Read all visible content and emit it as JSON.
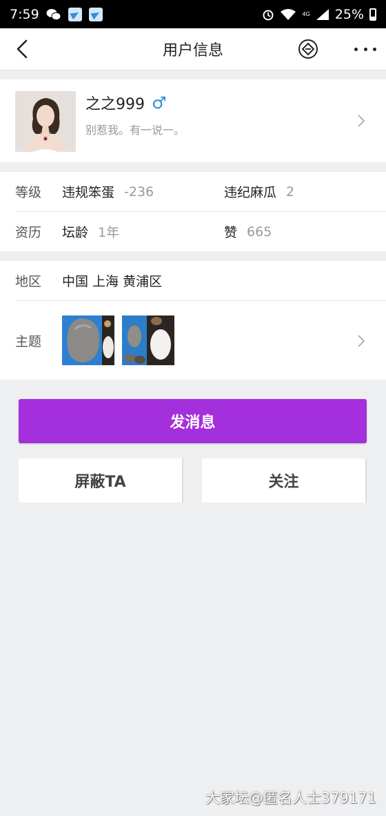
{
  "status_bar": {
    "time": "7:59",
    "battery": "25%",
    "network": "4G"
  },
  "nav": {
    "title": "用户信息"
  },
  "profile": {
    "username": "之之999",
    "gender_symbol": "♂",
    "signature": "别惹我。有一说一。"
  },
  "info": {
    "level_label": "等级",
    "level_name": "违规笨蛋",
    "level_value": "-236",
    "violation_label": "违纪麻瓜",
    "violation_value": "2",
    "resume_label": "资历",
    "age_label": "坛龄",
    "age_value": "1年",
    "likes_label": "赞",
    "likes_value": "665"
  },
  "location": {
    "label": "地区",
    "value": "中国 上海 黄浦区"
  },
  "topics": {
    "label": "主题"
  },
  "actions": {
    "message": "发消息",
    "block": "屏蔽TA",
    "follow": "关注"
  },
  "watermark": "大家坛@匿名人士379171",
  "colors": {
    "accent": "#a42fdc",
    "gender": "#2a8ed8"
  }
}
